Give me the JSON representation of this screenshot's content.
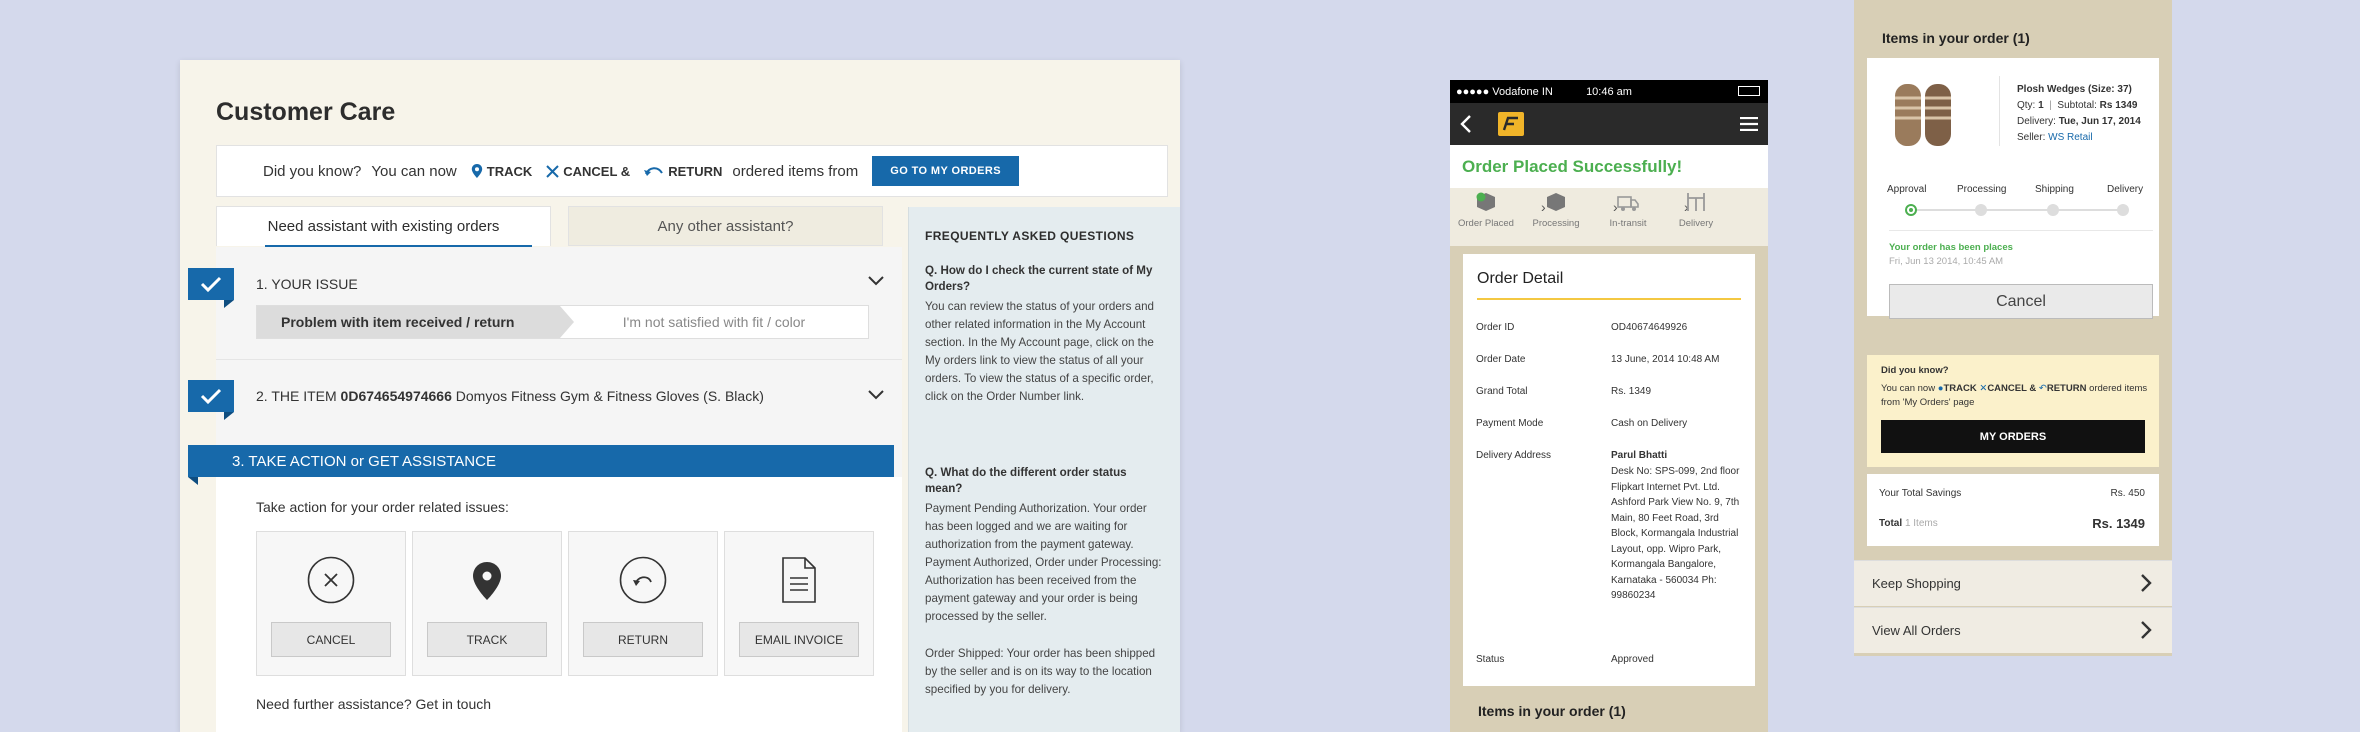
{
  "desktop": {
    "title": "Customer Care",
    "did_you_know": {
      "prefix": "Did you know?",
      "you_can_now": "You can now",
      "track": "TRACK",
      "cancel": "CANCEL &",
      "return": "RETURN",
      "suffix": "ordered items from",
      "button": "GO TO MY ORDERS"
    },
    "tabs": [
      "Need assistant with existing orders",
      "Any other assistant?"
    ],
    "step1": {
      "label": "1. YOUR ISSUE",
      "selected": "Problem with item received / return",
      "sub": "I'm not satisfied with fit / color"
    },
    "step2": {
      "prefix": "2. THE ITEM",
      "item_id": "0D674654974666",
      "item_name": "Domyos Fitness Gym & Fitness Gloves (S. Black)"
    },
    "step3": {
      "label": "3. TAKE ACTION or GET ASSISTANCE",
      "prompt": "Take action for your order related issues:",
      "actions": [
        "CANCEL",
        "TRACK",
        "RETURN",
        "EMAIL INVOICE"
      ],
      "further": "Need further assistance? Get in touch"
    },
    "faq": {
      "heading": "FREQUENTLY ASKED QUESTIONS",
      "q1": "Q. How do I check the current state of My Orders?",
      "a1": "You can review the status of your orders and other related information in the My Account section. In the My Account page, click on the My orders link to view the status of all your orders. To view the status of a specific order, click on the Order Number link.",
      "q2": "Q. What do the different order status mean?",
      "a2": "Payment Pending Authorization. Your order has been logged and we are waiting for authorization from the payment gateway. Payment Authorized, Order under Processing: Authorization has been received from the payment gateway and your order is being processed by the seller.",
      "a3": "Order Shipped: Your order has been shipped by the seller and is on its way to the location specified by you for delivery."
    }
  },
  "phone1": {
    "carrier": "●●●●● Vodafone IN",
    "time": "10:46 am",
    "placed": "Order Placed Successfully!",
    "steps": [
      "Order Placed",
      "Processing",
      "In-transit",
      "Delivery"
    ],
    "detail_title": "Order Detail",
    "rows": [
      {
        "label": "Order ID",
        "value": "OD40674649926"
      },
      {
        "label": "Order Date",
        "value": "13 June, 2014 10:48 AM"
      },
      {
        "label": "Grand Total",
        "value": "Rs. 1349"
      },
      {
        "label": "Payment Mode",
        "value": "Cash on Delivery"
      }
    ],
    "address_label": "Delivery Address",
    "address_name": "Parul Bhatti",
    "address": "Desk No: SPS-099, 2nd floor Flipkart Internet Pvt. Ltd. Ashford Park View No. 9, 7th Main, 80 Feet Road, 3rd Block, Kormangala Industrial Layout, opp. Wipro Park, Kormangala Bangalore, Karnataka - 560034 Ph: 99860234",
    "status_label": "Status",
    "status_value": "Approved",
    "items_heading": "Items in your order (1)"
  },
  "phone2": {
    "items_heading": "Items in your order (1)",
    "product": {
      "name": "Plosh Wedges (Size: 37)",
      "qty_label": "Qty:",
      "qty": "1",
      "subtotal_label": "Subtotal:",
      "subtotal": "Rs 1349",
      "delivery_label": "Delivery:",
      "delivery": "Tue, Jun 17, 2014",
      "seller_label": "Seller:",
      "seller": "WS Retail"
    },
    "timeline": [
      "Approval",
      "Processing",
      "Shipping",
      "Delivery"
    ],
    "status_msg": "Your order has been places",
    "status_time": "Fri, Jun 13 2014, 10:45 AM",
    "cancel": "Cancel",
    "dyk": {
      "heading": "Did you know?",
      "you_can_now": "You can now",
      "track": "TRACK",
      "cancel": "CANCEL &",
      "return": "RETURN",
      "suffix": "ordered items from 'My Orders' page",
      "button": "MY ORDERS"
    },
    "savings_label": "Your Total Savings",
    "savings": "Rs. 450",
    "total_label": "Total",
    "total_items": "1 Items",
    "total": "Rs. 1349",
    "keep_shopping": "Keep Shopping",
    "view_all": "View All Orders"
  },
  "colors": {
    "accent_blue": "#1769aa",
    "success_green": "#4caf50",
    "background": "#d4d9ec",
    "panel_beige": "#d8cfb6"
  }
}
